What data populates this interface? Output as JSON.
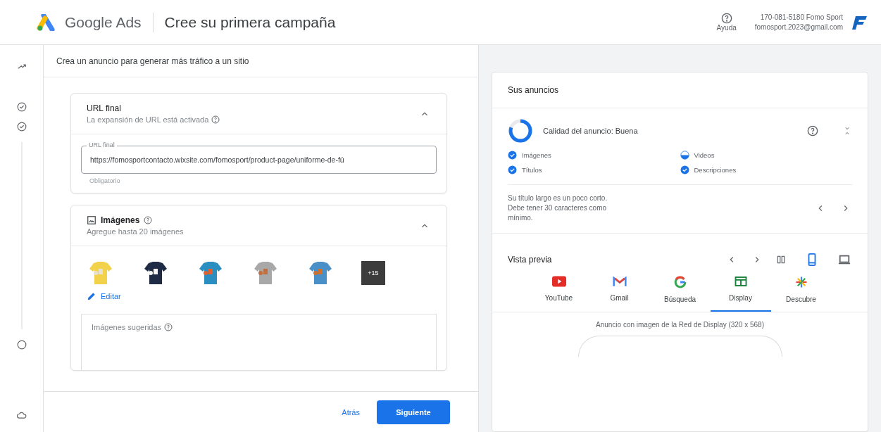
{
  "header": {
    "product": "Google Ads",
    "title": "Cree su primera campaña",
    "help": "Ayuda",
    "account_id": "170-081-5180 Fomo Sport",
    "account_email": "fomosport.2023@gmail.com"
  },
  "steps": [
    {
      "checked": true
    },
    {
      "checked": true
    },
    {
      "checked": false
    }
  ],
  "left": {
    "subtitle": "Crea un anuncio para generar más tráfico a un sitio",
    "url_card": {
      "title": "URL final",
      "subtitle": "La expansión de URL está activada",
      "expanded": true,
      "field_label": "URL final",
      "value": "https://fomosportcontacto.wixsite.com/fomosport/product-page/uniforme-de-fú",
      "hint": "Obligatorio"
    },
    "images_card": {
      "title": "Imágenes",
      "subtitle": "Agregue hasta 20 imágenes",
      "expanded": true,
      "more": "+15",
      "edit": "Editar",
      "suggested_title": "Imágenes sugeridas"
    },
    "back": "Atrás",
    "next": "Siguiente"
  },
  "right": {
    "title": "Sus anuncios",
    "quality": "Calidad del anuncio: Buena",
    "level": 0.8,
    "checklist": [
      {
        "label": "Imágenes",
        "checked": true
      },
      {
        "label": "Videos",
        "checked": false
      },
      {
        "label": "Títulos",
        "checked": true
      },
      {
        "label": "Descripciones",
        "checked": true
      }
    ],
    "tip": "Su título largo es un poco corto. Debe tener 30 caracteres como mínimo.",
    "preview_title": "Vista previa",
    "devices": [
      {
        "kind": "mobile",
        "selected": true
      },
      {
        "kind": "desktop",
        "selected": false
      }
    ],
    "channels": [
      {
        "kind": "youtube",
        "label": "YouTube",
        "selected": false
      },
      {
        "kind": "gmail",
        "label": "Gmail",
        "selected": false
      },
      {
        "kind": "search",
        "label": "Búsqueda",
        "selected": false
      },
      {
        "kind": "display",
        "label": "Display",
        "selected": true
      },
      {
        "kind": "discover",
        "label": "Descubre",
        "selected": false
      }
    ],
    "preview_caption": "Anuncio con imagen de la Red de Display (320 x 568)"
  }
}
